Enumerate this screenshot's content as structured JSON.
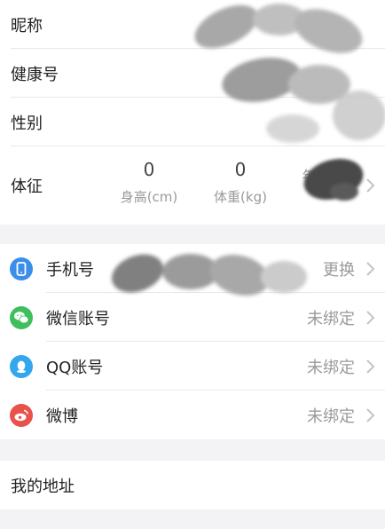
{
  "profile": {
    "nickname_label": "昵称",
    "health_id_label": "健康号",
    "gender_label": "性别",
    "body_label": "体征",
    "metrics": [
      {
        "value": "0",
        "caption": "身高(cm)"
      },
      {
        "value": "0",
        "caption": "体重(kg)"
      },
      {
        "value": "",
        "caption": "年龄(岁)"
      }
    ]
  },
  "accounts": {
    "items": [
      {
        "label": "手机号",
        "status": "更换",
        "icon": "phone-icon",
        "color": "#3b8eea"
      },
      {
        "label": "微信账号",
        "status": "未绑定",
        "icon": "wechat-icon",
        "color": "#3fbf5c"
      },
      {
        "label": "QQ账号",
        "status": "未绑定",
        "icon": "qq-icon",
        "color": "#33a7ee"
      },
      {
        "label": "微博",
        "status": "未绑定",
        "icon": "weibo-icon",
        "color": "#e9524a"
      }
    ]
  },
  "address": {
    "label": "我的地址"
  },
  "colors": {
    "background": "#f3f3f5",
    "secondary_text": "#9a9a9e",
    "divider": "#e8e8ea"
  }
}
